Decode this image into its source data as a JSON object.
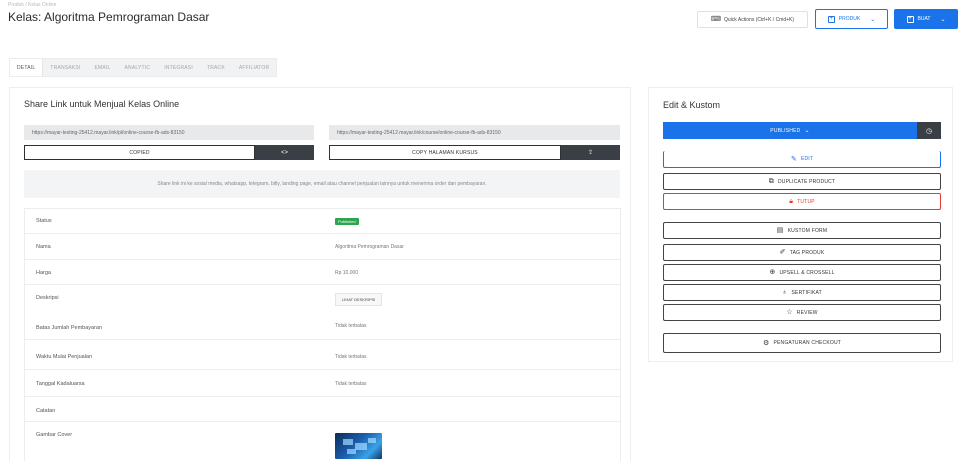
{
  "breadcrumb": "Produk / Kelas Online",
  "page_title": "Kelas: Algoritma Pemrograman Dasar",
  "header": {
    "quick_actions_label": "Quick Actions (Ctrl+K / Cmd+K)",
    "produk_label": "PRODUK",
    "buat_label": "BUAT"
  },
  "tabs": [
    {
      "label": "DETAIL",
      "active": true
    },
    {
      "label": "TRANSAKSI",
      "active": false
    },
    {
      "label": "EMAIL",
      "active": false
    },
    {
      "label": "ANALYTIC",
      "active": false
    },
    {
      "label": "INTEGRASI",
      "active": false
    },
    {
      "label": "TRACK",
      "active": false
    },
    {
      "label": "AFFILIATOR",
      "active": false
    }
  ],
  "share": {
    "title": "Share Link untuk Menjual Kelas Online",
    "link_a": "https://mayar-testing-25412.mayar.link/pl/online-course-fb-ads-83150",
    "link_b": "https://mayar-testing-25412.mayar.link/course/online-course-fb-ads-83150",
    "copy_a_label": "COPIED",
    "copy_b_label": "COPY HALAMAN KURSUS",
    "info_text": "Share link ini ke sosial media, whatsapp, telegram, bitly, landing page, email atau channel penjualan lainnya untuk menerima order dan pembayaran."
  },
  "details": {
    "status_label": "Status",
    "status_value": "Published",
    "nama_label": "Nama",
    "nama_value": "Algoritma Pemrograman Dasar",
    "harga_label": "Harga",
    "harga_value": "Rp 10.000",
    "deskripsi_label": "Deskripsi",
    "deskripsi_button": "LIHAT DESKRIPSI",
    "batas_label": "Batas Jumlah Pembayaran",
    "batas_value": "Tidak terbatas",
    "waktu_label": "Waktu Mulai Penjualan",
    "waktu_value": "Tidak terbatas",
    "tanggal_label": "Tanggal Kadaluarsa",
    "tanggal_value": "Tidak terbatas",
    "catatan_label": "Catatan",
    "cover_label": "Gambar Cover"
  },
  "edit_panel": {
    "title": "Edit & Kustom",
    "publish_label": "PUBLISHED",
    "edit_label": "EDIT",
    "duplicate_label": "DUPLICATE PRODUCT",
    "tutup_label": "TUTUP",
    "kustom_form_label": "KUSTOM FORM",
    "tag_produk_label": "TAG PRODUK",
    "upsell_label": "UPSELL & CROSSELL",
    "sertifikat_label": "SERTIFIKAT",
    "review_label": "REVIEW",
    "checkout_label": "PENGATURAN CHECKOUT"
  },
  "colors": {
    "primary": "#1a73e8",
    "dark": "#3a3f45",
    "danger": "#e53935",
    "success": "#2da44e"
  }
}
